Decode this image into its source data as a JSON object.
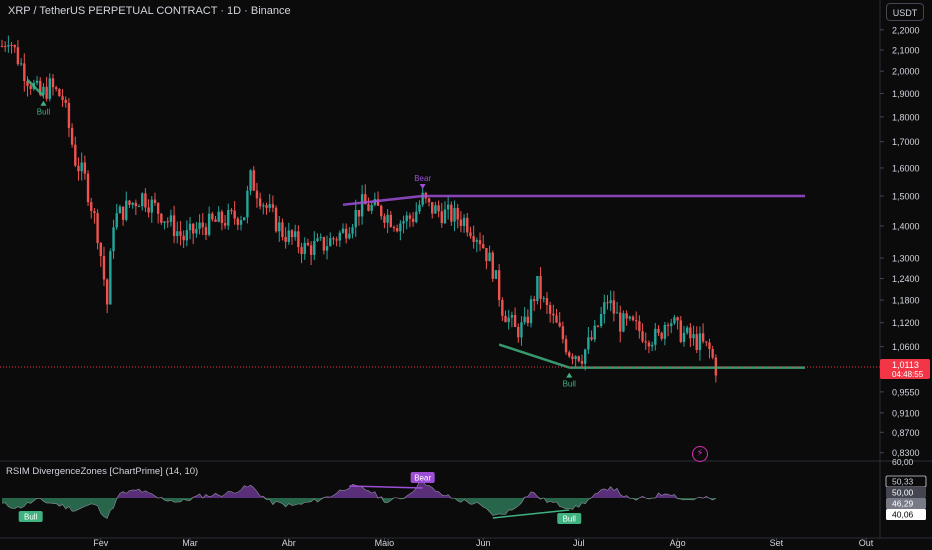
{
  "header": {
    "title": "XRP / TetherUS PERPETUAL CONTRACT · 1D · Binance",
    "currency": "USDT"
  },
  "price_axis": {
    "ticks": [
      "2,2000",
      "2,1000",
      "2,0000",
      "1,9000",
      "1,8000",
      "1,7000",
      "1,6000",
      "1,5000",
      "1,4000",
      "1,3000",
      "1,2400",
      "1,1800",
      "1,1200",
      "1,0600",
      "0,9550",
      "0,9100",
      "0,8700",
      "0,8300"
    ],
    "last_price": "1,0113",
    "countdown": "04:48:55"
  },
  "time_axis": {
    "labels": [
      "Fev",
      "Mar",
      "Abr",
      "Maio",
      "Jun",
      "Jul",
      "Ago",
      "Set",
      "Out"
    ]
  },
  "indicator": {
    "title": "RSIM DivergenceZones [ChartPrime] (14, 10)",
    "scale_top": "60,00",
    "values": [
      "50,33",
      "50,00",
      "46,29",
      "40,06"
    ],
    "labels": [
      "Bull",
      "Bear",
      "Bull"
    ]
  },
  "price_labels": [
    "Bull",
    "Bear",
    "Bull"
  ],
  "colors": {
    "up": "#26a69a",
    "down": "#ef5350",
    "bull": "#3fb27f",
    "bear": "#9c4fd6",
    "price_tag": "#f23645"
  },
  "chart_data": {
    "type": "candlestick",
    "ylabel": "",
    "xlabel": "",
    "x_range": [
      "2025-01-01",
      "2025-10-01"
    ],
    "ylim": [
      0.82,
      2.24
    ],
    "close_keypoints": [
      {
        "date": "2025-01-01",
        "close": 2.12
      },
      {
        "date": "2025-01-03",
        "close": 2.17
      },
      {
        "date": "2025-01-06",
        "close": 2.06
      },
      {
        "date": "2025-01-09",
        "close": 1.97
      },
      {
        "date": "2025-01-13",
        "close": 1.89
      },
      {
        "date": "2025-01-16",
        "close": 1.93
      },
      {
        "date": "2025-01-20",
        "close": 1.88
      },
      {
        "date": "2025-01-24",
        "close": 1.63
      },
      {
        "date": "2025-01-27",
        "close": 1.56
      },
      {
        "date": "2025-01-31",
        "close": 1.38
      },
      {
        "date": "2025-02-03",
        "close": 1.17
      },
      {
        "date": "2025-02-05",
        "close": 1.42
      },
      {
        "date": "2025-02-10",
        "close": 1.47
      },
      {
        "date": "2025-02-14",
        "close": 1.5
      },
      {
        "date": "2025-02-20",
        "close": 1.44
      },
      {
        "date": "2025-02-27",
        "close": 1.36
      },
      {
        "date": "2025-03-05",
        "close": 1.4
      },
      {
        "date": "2025-03-12",
        "close": 1.42
      },
      {
        "date": "2025-03-18",
        "close": 1.44
      },
      {
        "date": "2025-03-20",
        "close": 1.56
      },
      {
        "date": "2025-03-25",
        "close": 1.46
      },
      {
        "date": "2025-03-30",
        "close": 1.38
      },
      {
        "date": "2025-04-06",
        "close": 1.33
      },
      {
        "date": "2025-04-12",
        "close": 1.34
      },
      {
        "date": "2025-04-18",
        "close": 1.38
      },
      {
        "date": "2025-04-24",
        "close": 1.47
      },
      {
        "date": "2025-04-30",
        "close": 1.45
      },
      {
        "date": "2025-05-05",
        "close": 1.41
      },
      {
        "date": "2025-05-10",
        "close": 1.43
      },
      {
        "date": "2025-05-13",
        "close": 1.49
      },
      {
        "date": "2025-05-15",
        "close": 1.46
      },
      {
        "date": "2025-05-20",
        "close": 1.44
      },
      {
        "date": "2025-05-26",
        "close": 1.42
      },
      {
        "date": "2025-05-31",
        "close": 1.36
      },
      {
        "date": "2025-06-04",
        "close": 1.27
      },
      {
        "date": "2025-06-07",
        "close": 1.16
      },
      {
        "date": "2025-06-11",
        "close": 1.1
      },
      {
        "date": "2025-06-14",
        "close": 1.11
      },
      {
        "date": "2025-06-18",
        "close": 1.22
      },
      {
        "date": "2025-06-20",
        "close": 1.17
      },
      {
        "date": "2025-06-24",
        "close": 1.11
      },
      {
        "date": "2025-06-28",
        "close": 1.05
      },
      {
        "date": "2025-07-02",
        "close": 1.04
      },
      {
        "date": "2025-07-06",
        "close": 1.09
      },
      {
        "date": "2025-07-10",
        "close": 1.18
      },
      {
        "date": "2025-07-14",
        "close": 1.12
      },
      {
        "date": "2025-07-18",
        "close": 1.11
      },
      {
        "date": "2025-07-22",
        "close": 1.09
      },
      {
        "date": "2025-07-26",
        "close": 1.08
      },
      {
        "date": "2025-07-29",
        "close": 1.14
      },
      {
        "date": "2025-08-01",
        "close": 1.1
      },
      {
        "date": "2025-08-05",
        "close": 1.08
      },
      {
        "date": "2025-08-08",
        "close": 1.07
      },
      {
        "date": "2025-08-11",
        "close": 1.05
      },
      {
        "date": "2025-08-13",
        "close": 1.01
      }
    ],
    "divergence_lines": [
      {
        "type": "bull",
        "from": {
          "date": "2025-01-09",
          "price": 1.96
        },
        "to": {
          "date": "2025-01-14",
          "price": 1.89
        }
      },
      {
        "type": "bear",
        "from": {
          "date": "2025-04-18",
          "price": 1.47
        },
        "to": {
          "date": "2025-05-13",
          "price": 1.5
        }
      },
      {
        "type": "bear_level",
        "from": {
          "date": "2025-05-13",
          "price": 1.5
        },
        "to": {
          "date": "2025-09-10",
          "price": 1.5
        }
      },
      {
        "type": "bull",
        "from": {
          "date": "2025-06-06",
          "price": 1.065
        },
        "to": {
          "date": "2025-06-28",
          "price": 1.01
        }
      },
      {
        "type": "bull_level",
        "from": {
          "date": "2025-06-28",
          "price": 1.01
        },
        "to": {
          "date": "2025-09-10",
          "price": 1.01
        }
      }
    ],
    "rsi": {
      "ylim": [
        30,
        60
      ],
      "mid": 46,
      "keypoints": [
        {
          "date": "2025-01-01",
          "v": 43
        },
        {
          "date": "2025-01-06",
          "v": 41
        },
        {
          "date": "2025-01-12",
          "v": 45
        },
        {
          "date": "2025-01-18",
          "v": 43
        },
        {
          "date": "2025-01-24",
          "v": 40
        },
        {
          "date": "2025-01-30",
          "v": 43
        },
        {
          "date": "2025-02-03",
          "v": 36
        },
        {
          "date": "2025-02-07",
          "v": 48
        },
        {
          "date": "2025-02-13",
          "v": 50
        },
        {
          "date": "2025-02-19",
          "v": 46
        },
        {
          "date": "2025-02-26",
          "v": 44
        },
        {
          "date": "2025-03-04",
          "v": 47
        },
        {
          "date": "2025-03-12",
          "v": 48
        },
        {
          "date": "2025-03-20",
          "v": 52
        },
        {
          "date": "2025-03-26",
          "v": 44
        },
        {
          "date": "2025-04-02",
          "v": 42
        },
        {
          "date": "2025-04-08",
          "v": 44
        },
        {
          "date": "2025-04-14",
          "v": 47
        },
        {
          "date": "2025-04-20",
          "v": 52
        },
        {
          "date": "2025-04-26",
          "v": 50
        },
        {
          "date": "2025-05-02",
          "v": 44
        },
        {
          "date": "2025-05-08",
          "v": 47
        },
        {
          "date": "2025-05-13",
          "v": 55
        },
        {
          "date": "2025-05-17",
          "v": 49
        },
        {
          "date": "2025-05-24",
          "v": 45
        },
        {
          "date": "2025-05-30",
          "v": 43
        },
        {
          "date": "2025-06-05",
          "v": 37
        },
        {
          "date": "2025-06-10",
          "v": 40
        },
        {
          "date": "2025-06-16",
          "v": 49
        },
        {
          "date": "2025-06-20",
          "v": 45
        },
        {
          "date": "2025-06-26",
          "v": 42
        },
        {
          "date": "2025-06-30",
          "v": 41
        },
        {
          "date": "2025-07-06",
          "v": 47
        },
        {
          "date": "2025-07-11",
          "v": 52
        },
        {
          "date": "2025-07-17",
          "v": 45
        },
        {
          "date": "2025-07-23",
          "v": 46
        },
        {
          "date": "2025-07-29",
          "v": 49
        },
        {
          "date": "2025-08-03",
          "v": 45
        },
        {
          "date": "2025-08-09",
          "v": 46
        },
        {
          "date": "2025-08-13",
          "v": 45
        }
      ],
      "divergences": [
        {
          "type": "bear",
          "from": {
            "date": "2025-04-20",
            "v": 52
          },
          "to": {
            "date": "2025-05-13",
            "v": 51
          }
        },
        {
          "type": "bull",
          "from": {
            "date": "2025-06-04",
            "v": 36
          },
          "to": {
            "date": "2025-06-28",
            "v": 40
          }
        }
      ]
    }
  }
}
